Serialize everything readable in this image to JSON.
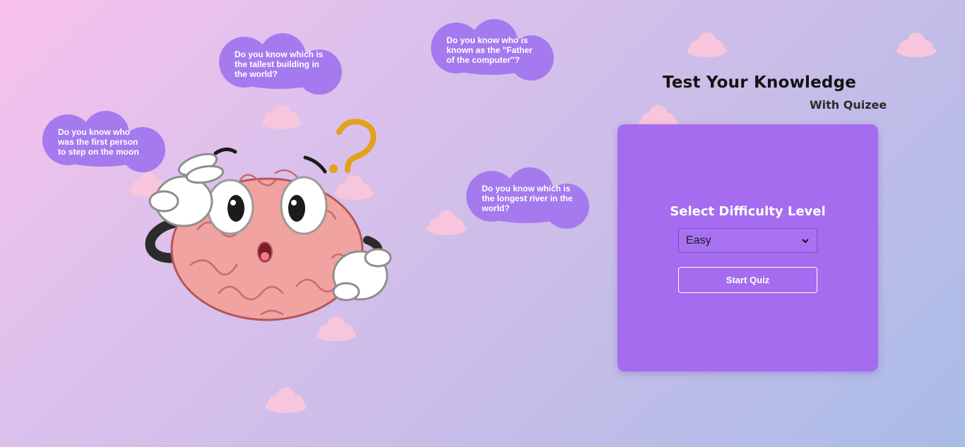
{
  "header": {
    "title": "Test Your Knowledge",
    "subtitle": "With Quizee"
  },
  "bubbles": [
    {
      "text": "Do you know which is the tallest building in the world?"
    },
    {
      "text": "Do you know who is known as the \"Father of the computer\"?"
    },
    {
      "text": "Do you know who was the first person to step on the moon"
    },
    {
      "text": "Do you know which is the longest river in the world?"
    }
  ],
  "quiz_card": {
    "heading": "Select Difficulty Level",
    "difficulty_selected": "Easy",
    "start_label": "Start Quiz"
  },
  "icons": {
    "mascot": "thinking-brain-icon",
    "question_mark": "question-mark-icon",
    "dropdown": "chevron-down-icon",
    "decor": "pink-cloud-icon"
  },
  "colors": {
    "card": "#a56cf0",
    "bubble": "#a57aee",
    "pink_cloud": "#f7c6dc",
    "question_mark": "#e4a11a"
  }
}
